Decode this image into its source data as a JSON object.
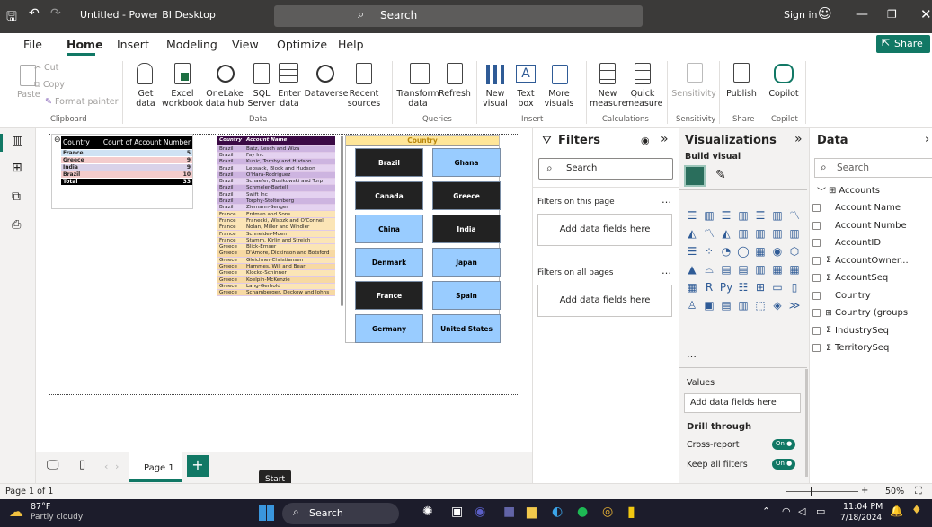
{
  "titlebar": {
    "title": "Untitled - Power BI Desktop",
    "search": "Search",
    "signin": "Sign in"
  },
  "menu": {
    "file": "File",
    "home": "Home",
    "insert": "Insert",
    "modeling": "Modeling",
    "view": "View",
    "optimize": "Optimize",
    "help": "Help",
    "share": "Share"
  },
  "ribbon": {
    "cut": "Cut",
    "copy": "Copy",
    "paste": "Paste",
    "format_painter": "Format painter",
    "get_data": "Get data",
    "excel": "Excel workbook",
    "onelake": "OneLake data hub",
    "sql": "SQL Server",
    "enter_data": "Enter data",
    "dataverse": "Dataverse",
    "recent": "Recent sources",
    "transform": "Transform data",
    "refresh": "Refresh",
    "new_visual": "New visual",
    "text_box": "Text box",
    "more_visuals": "More visuals",
    "new_measure": "New measure",
    "quick_measure": "Quick measure",
    "sensitivity": "Sensitivity",
    "publish": "Publish",
    "copilot": "Copilot",
    "groups": {
      "clipboard": "Clipboard",
      "data": "Data",
      "queries": "Queries",
      "insert": "Insert",
      "calculations": "Calculations",
      "sensitivity": "Sensitivity",
      "share": "Share",
      "copilot": "Copilot"
    }
  },
  "matrix": {
    "h1": "Country",
    "h2": "Count of Account Number",
    "rows": [
      {
        "c": "France",
        "v": "5"
      },
      {
        "c": "Greece",
        "v": "9"
      },
      {
        "c": "India",
        "v": "9"
      },
      {
        "c": "Brazil",
        "v": "10"
      }
    ],
    "total_label": "Total",
    "total": "33"
  },
  "table2": {
    "h1": "Country",
    "h2": "Account Name",
    "rows": [
      [
        "Brazil",
        "Batz, Lesch and Wiza"
      ],
      [
        "Brazil",
        "Fay Inc"
      ],
      [
        "Brazil",
        "Kuhic, Torphy and Hudson"
      ],
      [
        "Brazil",
        "Lebsack, Block and Hudson"
      ],
      [
        "Brazil",
        "O'Hara-Rodriguez"
      ],
      [
        "Brazil",
        "Schaefer, Gusikowski and Torp"
      ],
      [
        "Brazil",
        "Schmeler-Bartell"
      ],
      [
        "Brazil",
        "Swift Inc"
      ],
      [
        "Brazil",
        "Torphy-Stoltenberg"
      ],
      [
        "Brazil",
        "Ziemann-Senger"
      ],
      [
        "France",
        "Erdman and Sons"
      ],
      [
        "France",
        "Franecki, Wisozk and O'Connell"
      ],
      [
        "France",
        "Nolan, Miller and Windler"
      ],
      [
        "France",
        "Schneider-Moen"
      ],
      [
        "France",
        "Stamm, Kirlin and Streich"
      ],
      [
        "Greece",
        "Blick-Ernser"
      ],
      [
        "Greece",
        "D'Amore, Dickinson and Botsford"
      ],
      [
        "Greece",
        "Gleichner-Christiansen"
      ],
      [
        "Greece",
        "Hammes, Will and Bear"
      ],
      [
        "Greece",
        "Klocko-Schinner"
      ],
      [
        "Greece",
        "Koelpin-McKenzie"
      ],
      [
        "Greece",
        "Lang-Gerhold"
      ],
      [
        "Greece",
        "Schamberger, Deckow and Johns"
      ]
    ]
  },
  "slicer": {
    "header": "Country",
    "items": [
      {
        "l": "Brazil",
        "sel": true
      },
      {
        "l": "Ghana",
        "sel": false
      },
      {
        "l": "Canada",
        "sel": true
      },
      {
        "l": "Greece",
        "sel": true
      },
      {
        "l": "China",
        "sel": false
      },
      {
        "l": "India",
        "sel": true
      },
      {
        "l": "Denmark",
        "sel": false
      },
      {
        "l": "Japan",
        "sel": false
      },
      {
        "l": "France",
        "sel": true
      },
      {
        "l": "Spain",
        "sel": false
      },
      {
        "l": "Germany",
        "sel": false
      },
      {
        "l": "United States",
        "sel": false
      }
    ]
  },
  "pagebar": {
    "page": "Page 1",
    "tooltip": "Start"
  },
  "filters": {
    "title": "Filters",
    "search": "Search",
    "on_page": "Filters on this page",
    "add1": "Add data fields here",
    "all_pages": "Filters on all pages",
    "add2": "Add data fields here"
  },
  "viz": {
    "title": "Visualizations",
    "build": "Build visual",
    "values": "Values",
    "add": "Add data fields here",
    "drill": "Drill through",
    "cross": "Cross-report",
    "keep": "Keep all filters",
    "on": "On"
  },
  "data": {
    "title": "Data",
    "search": "Search",
    "table": "Accounts",
    "fields": [
      {
        "n": "Account Name",
        "s": ""
      },
      {
        "n": "Account Numbe",
        "s": ""
      },
      {
        "n": "AccountID",
        "s": ""
      },
      {
        "n": "AccountOwner...",
        "s": "Σ"
      },
      {
        "n": "AccountSeq",
        "s": "Σ"
      },
      {
        "n": "Country",
        "s": ""
      },
      {
        "n": "Country (groups",
        "s": "⊞"
      },
      {
        "n": "IndustrySeq",
        "s": "Σ"
      },
      {
        "n": "TerritorySeq",
        "s": "Σ"
      }
    ]
  },
  "status": {
    "page": "Page 1 of 1",
    "zoom": "50%"
  },
  "taskbar": {
    "temp": "87°F",
    "weather": "Partly cloudy",
    "search": "Search",
    "time": "11:04 PM",
    "date": "7/18/2024"
  },
  "colors": {
    "accent": "#117865",
    "slicer_dark": "#222222",
    "slicer_light": "#99ccff",
    "table_header": "#3b0a45"
  }
}
